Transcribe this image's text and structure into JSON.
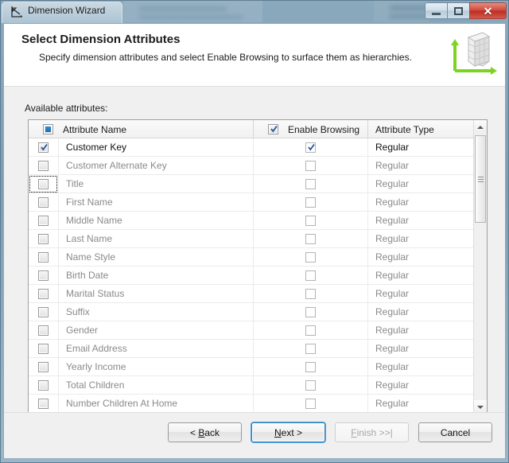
{
  "window": {
    "title": "Dimension Wizard",
    "icon": "chart-axes-icon",
    "controls": {
      "minimize": "minimize-icon",
      "restore": "restore-icon",
      "close": "close-icon"
    }
  },
  "header": {
    "title": "Select Dimension Attributes",
    "subtitle": "Specify dimension attributes and select Enable Browsing to surface them as hierarchies.",
    "art": "dimension-cube-icon",
    "accent_color": "#7ed321"
  },
  "body": {
    "available_label": "Available attributes:"
  },
  "grid": {
    "columns": [
      {
        "key": "name",
        "label": "Attribute Name",
        "header_checkbox": "mixed"
      },
      {
        "key": "browsing",
        "label": "Enable Browsing",
        "header_checkbox": "checked"
      },
      {
        "key": "type",
        "label": "Attribute Type",
        "header_checkbox": "none"
      }
    ],
    "rows": [
      {
        "name": "Customer Key",
        "checked": true,
        "browsing": true,
        "type": "Regular",
        "enabled": true,
        "focused": false
      },
      {
        "name": "Customer Alternate Key",
        "checked": false,
        "browsing": false,
        "type": "Regular",
        "enabled": false,
        "focused": false
      },
      {
        "name": "Title",
        "checked": false,
        "browsing": false,
        "type": "Regular",
        "enabled": false,
        "focused": true
      },
      {
        "name": "First Name",
        "checked": false,
        "browsing": false,
        "type": "Regular",
        "enabled": false,
        "focused": false
      },
      {
        "name": "Middle Name",
        "checked": false,
        "browsing": false,
        "type": "Regular",
        "enabled": false,
        "focused": false
      },
      {
        "name": "Last Name",
        "checked": false,
        "browsing": false,
        "type": "Regular",
        "enabled": false,
        "focused": false
      },
      {
        "name": "Name Style",
        "checked": false,
        "browsing": false,
        "type": "Regular",
        "enabled": false,
        "focused": false
      },
      {
        "name": "Birth Date",
        "checked": false,
        "browsing": false,
        "type": "Regular",
        "enabled": false,
        "focused": false
      },
      {
        "name": "Marital Status",
        "checked": false,
        "browsing": false,
        "type": "Regular",
        "enabled": false,
        "focused": false
      },
      {
        "name": "Suffix",
        "checked": false,
        "browsing": false,
        "type": "Regular",
        "enabled": false,
        "focused": false
      },
      {
        "name": "Gender",
        "checked": false,
        "browsing": false,
        "type": "Regular",
        "enabled": false,
        "focused": false
      },
      {
        "name": "Email Address",
        "checked": false,
        "browsing": false,
        "type": "Regular",
        "enabled": false,
        "focused": false
      },
      {
        "name": "Yearly Income",
        "checked": false,
        "browsing": false,
        "type": "Regular",
        "enabled": false,
        "focused": false
      },
      {
        "name": "Total Children",
        "checked": false,
        "browsing": false,
        "type": "Regular",
        "enabled": false,
        "focused": false
      },
      {
        "name": "Number Children At Home",
        "checked": false,
        "browsing": false,
        "type": "Regular",
        "enabled": false,
        "focused": false
      }
    ],
    "scrollbar": {
      "up": "scroll-up-icon",
      "down": "scroll-down-icon",
      "thumb_position": "near-top"
    }
  },
  "footer": {
    "buttons": [
      {
        "id": "back",
        "label": "< Back",
        "accesskey": "B",
        "state": "normal"
      },
      {
        "id": "next",
        "label": "Next >",
        "accesskey": "N",
        "state": "focused"
      },
      {
        "id": "finish",
        "label": "Finish >>|",
        "accesskey": "F",
        "state": "disabled"
      },
      {
        "id": "cancel",
        "label": "Cancel",
        "accesskey": "",
        "state": "normal"
      }
    ]
  }
}
